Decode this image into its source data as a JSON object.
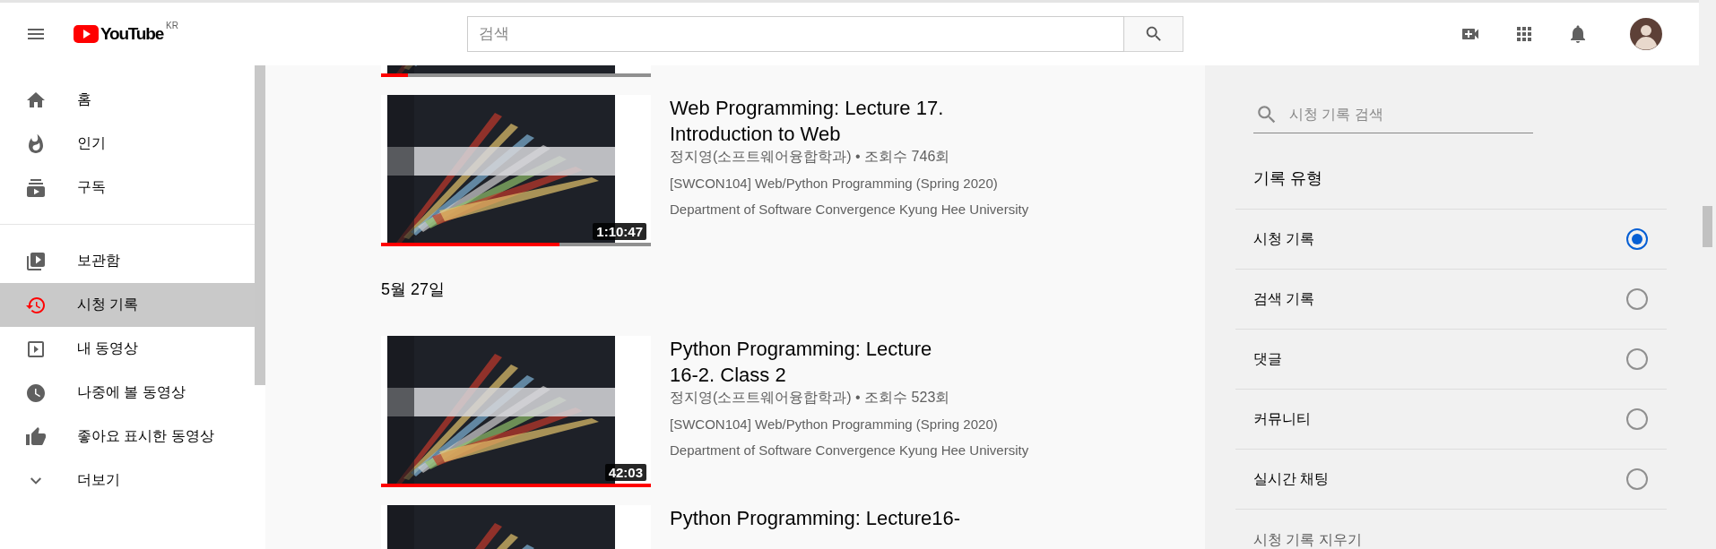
{
  "header": {
    "logo": "YouTube",
    "region": "KR",
    "search": {
      "placeholder": "검색"
    }
  },
  "sidebar": {
    "sections": [
      {
        "items": [
          {
            "label": "홈",
            "selected": false
          },
          {
            "label": "인기",
            "selected": false
          },
          {
            "label": "구독",
            "selected": false
          }
        ]
      },
      {
        "items": [
          {
            "label": "보관함",
            "selected": false
          },
          {
            "label": "시청 기록",
            "selected": true
          },
          {
            "label": "내 동영상",
            "selected": false
          },
          {
            "label": "나중에 볼 동영상",
            "selected": false
          },
          {
            "label": "좋아요 표시한 동영상",
            "selected": false
          },
          {
            "label": "더보기",
            "selected": false
          }
        ]
      }
    ]
  },
  "history": {
    "entries": [
      {
        "kind": "cut_video",
        "level": 0.1
      },
      {
        "kind": "video",
        "title": "Web Programming: Lecture 17. Introduction to Web",
        "meta": "정지영(소프트웨어융합학과) • 조회수 746회",
        "description": [
          "[SWCON104] Web/Python Programming (Spring 2020)",
          "Department of Software Convergence Kyung Hee University"
        ],
        "duration": "1:10:47",
        "level": 0.66
      },
      {
        "kind": "date",
        "label": "5월 27일"
      },
      {
        "kind": "video",
        "title": "Python Programming: Lecture 16-2. Class 2",
        "meta": "정지영(소프트웨어융합학과) • 조회수 523회",
        "description": [
          "[SWCON104] Web/Python Programming (Spring 2020)",
          "Department of Software Convergence Kyung Hee University"
        ],
        "duration": "42:03",
        "level": 1
      },
      {
        "kind": "video",
        "title": "Python Programming: Lecture16-"
      }
    ]
  },
  "panel": {
    "search": {
      "placeholder": "시청 기록 검색"
    },
    "heading": "기록 유형",
    "options": [
      {
        "label": "시청 기록",
        "selected": true
      },
      {
        "label": "검색 기록",
        "selected": false
      },
      {
        "label": "댓글",
        "selected": false
      },
      {
        "label": "커뮤니티",
        "selected": false
      },
      {
        "label": "실시간 채팅",
        "selected": false
      }
    ],
    "footer": "시청 기록 지우기"
  }
}
